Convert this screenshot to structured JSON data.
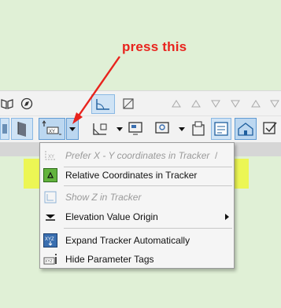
{
  "annotation": {
    "text": "press this",
    "color": "#e8231d"
  },
  "menu": {
    "items": [
      {
        "label": "Prefer X - Y coordinates in Tracker",
        "shortcut": "/",
        "enabled": false,
        "icon": "xy-coordinates-icon"
      },
      {
        "label": "Relative Coordinates in Tracker",
        "enabled": true,
        "icon": "relative-coordinates-icon",
        "checked": true
      },
      {
        "label": "Show Z in Tracker",
        "enabled": false,
        "icon": "show-z-icon"
      },
      {
        "label": "Elevation Value Origin",
        "enabled": true,
        "icon": "elevation-origin-icon",
        "has_submenu": true
      },
      {
        "label": "Expand Tracker Automatically",
        "enabled": true,
        "icon": "expand-tracker-icon"
      },
      {
        "label": "Hide Parameter Tags",
        "enabled": true,
        "icon": "hide-tags-icon"
      }
    ]
  },
  "colors": {
    "highlight": "#f0f828",
    "background": "#e0f0d6",
    "accent": "#5f9ad2"
  }
}
